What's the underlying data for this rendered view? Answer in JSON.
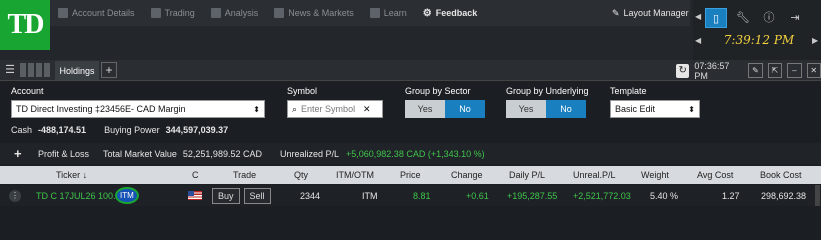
{
  "brand": {
    "logo_text": "TD"
  },
  "nav": {
    "items": [
      {
        "label": "Account Details",
        "icon": "account-details-icon"
      },
      {
        "label": "Trading",
        "icon": "trading-icon"
      },
      {
        "label": "Analysis",
        "icon": "analysis-icon"
      },
      {
        "label": "News & Markets",
        "icon": "news-icon"
      },
      {
        "label": "Learn",
        "icon": "learn-icon"
      },
      {
        "label": "Feedback",
        "icon": "feedback-icon"
      }
    ],
    "layout_manager": "Layout Manager"
  },
  "side_clock": "7:39:12 PM",
  "holdings_bar": {
    "tab": "Holdings",
    "time": "07:36:57 PM"
  },
  "account": {
    "label": "Account",
    "value": "TD Direct Investing ‡23456E- CAD Margin",
    "cash_label": "Cash",
    "cash_value": "-488,174.51",
    "buying_power_label": "Buying Power",
    "buying_power_value": "344,597,039.37"
  },
  "symbol": {
    "label": "Symbol",
    "placeholder": "Enter Symbol"
  },
  "group_by_sector": {
    "label": "Group by Sector",
    "yes": "Yes",
    "no": "No",
    "selected": "No"
  },
  "group_by_underlying": {
    "label": "Group by Underlying",
    "yes": "Yes",
    "no": "No",
    "selected": "No"
  },
  "template": {
    "label": "Template",
    "value": "Basic Edit"
  },
  "pl_bar": {
    "plus": "+",
    "profit_loss": "Profit & Loss",
    "total_market_value_label": "Total Market Value",
    "total_market_value": "52,251,989.52 CAD",
    "unrealized_label": "Unrealized P/L",
    "unrealized_value": "+5,060,982.38 CAD (+1,343.10 %)"
  },
  "table": {
    "headers": {
      "ticker": "Ticker ↓",
      "c": "C",
      "trade": "Trade",
      "qty": "Qty",
      "itm_otm": "ITM/OTM",
      "price": "Price",
      "change": "Change",
      "daily_pl": "Daily P/L",
      "unreal_pl": "Unreal.P/L",
      "weight": "Weight",
      "avg_cost": "Avg Cost",
      "book_cost": "Book Cost"
    },
    "rows": [
      {
        "ticker": "TD C 17JUL26 100.0",
        "ticker_badge": "ITM",
        "buy": "Buy",
        "sell": "Sell",
        "qty": "2344",
        "itm_otm": "ITM",
        "price": "8.81",
        "change": "+0.61",
        "daily_pl": "+195,287.55",
        "unreal_pl": "+2,521,772.03",
        "weight": "5.40 %",
        "avg_cost": "1.27",
        "book_cost": "298,692.38"
      }
    ]
  },
  "colors": {
    "brand_green": "#19a531",
    "accent_blue": "#1a7fbf",
    "gain_green": "#3fc54b",
    "clock_yellow": "#f2d040"
  }
}
